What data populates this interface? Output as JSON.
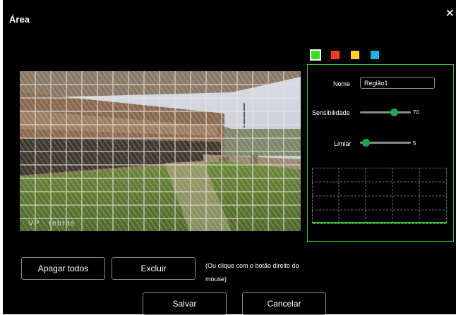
{
  "dialog": {
    "title": "Área",
    "close_glyph": "✕"
  },
  "preview": {
    "watermark": "VP · rebras"
  },
  "region": {
    "colors": [
      {
        "name": "region-color-green",
        "hex": "#3bdc1a",
        "active": true
      },
      {
        "name": "region-color-red",
        "hex": "#f23b1a",
        "active": false
      },
      {
        "name": "region-color-yellow",
        "hex": "#ffd21a",
        "active": false
      },
      {
        "name": "region-color-cyan",
        "hex": "#1ab4e6",
        "active": false
      }
    ],
    "name_label": "Nome",
    "name_value": "Região1",
    "sensitivity_label": "Sensibilidade",
    "sensitivity_value": 70,
    "threshold_label": "Limiar",
    "threshold_value": 5,
    "border_color": "#2ec52e"
  },
  "buttons": {
    "clear_all": "Apagar todos",
    "delete": "Excluir",
    "hint": "(Ou clique com o botão direito do mouse)",
    "save": "Salvar",
    "cancel": "Cancelar"
  },
  "icons": {
    "close": "close-icon"
  }
}
